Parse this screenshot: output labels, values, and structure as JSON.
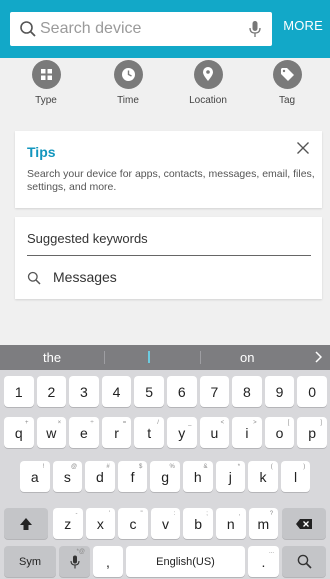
{
  "search": {
    "placeholder": "Search device",
    "more_label": "MORE"
  },
  "filters": [
    {
      "label": "Type",
      "icon": "grid-icon"
    },
    {
      "label": "Time",
      "icon": "clock-icon"
    },
    {
      "label": "Location",
      "icon": "location-pin-icon"
    },
    {
      "label": "Tag",
      "icon": "tag-icon"
    }
  ],
  "tips": {
    "title": "Tips",
    "body": "Search your device for apps, contacts, messages, email, files, settings, and more."
  },
  "suggested": {
    "heading": "Suggested keywords",
    "keywords": [
      "Messages"
    ]
  },
  "keyboard": {
    "predictions": [
      "the",
      "on"
    ],
    "number_row": [
      "1",
      "2",
      "3",
      "4",
      "5",
      "6",
      "7",
      "8",
      "9",
      "0"
    ],
    "row1": [
      "q",
      "w",
      "e",
      "r",
      "t",
      "y",
      "u",
      "i",
      "o",
      "p"
    ],
    "row1_hints": [
      "+",
      "×",
      "÷",
      "=",
      "/",
      "_",
      "<",
      ">",
      "[",
      "]"
    ],
    "row2": [
      "a",
      "s",
      "d",
      "f",
      "g",
      "h",
      "j",
      "k",
      "l"
    ],
    "row2_hints": [
      "!",
      "@",
      "#",
      "$",
      "%",
      "&",
      "*",
      "(",
      ")"
    ],
    "row3": [
      "z",
      "x",
      "c",
      "v",
      "b",
      "n",
      "m"
    ],
    "row3_hints": [
      "-",
      "'",
      "\"",
      ":",
      ";",
      ",",
      "?"
    ],
    "sym_label": "Sym",
    "comma_label": ",",
    "space_label": "English(US)",
    "period_label": ".",
    "period_hint": "...",
    "mic_hint": "*@"
  },
  "colors": {
    "accent": "#12a8c8",
    "tips_title": "#1296be",
    "icon_circle": "#7a7a7a"
  }
}
